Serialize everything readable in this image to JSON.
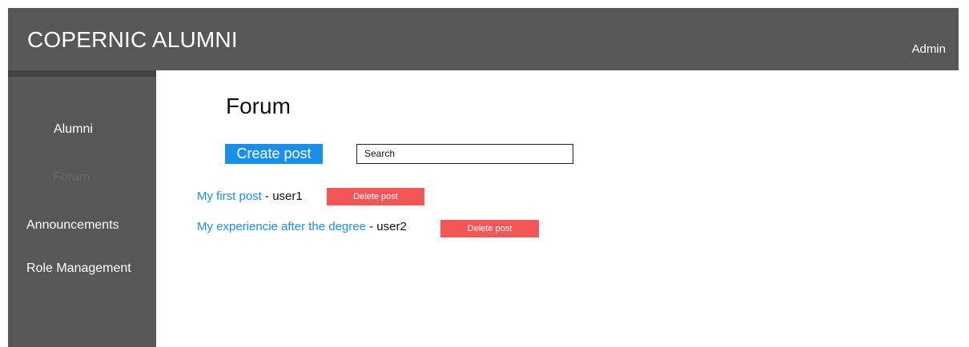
{
  "header": {
    "title": "COPERNIC ALUMNI",
    "user": "Admin"
  },
  "sidebar": {
    "items": [
      {
        "label": "Alumni",
        "active": false
      },
      {
        "label": "Forum",
        "active": true
      },
      {
        "label": "Announcements",
        "active": false
      },
      {
        "label": "Role Management",
        "active": false
      }
    ]
  },
  "main": {
    "title": "Forum",
    "create_label": "Create post",
    "search_value": "Search"
  },
  "posts": [
    {
      "title": "My first post",
      "separator": " - ",
      "author": "user1",
      "delete_label": "Delete post"
    },
    {
      "title": "My experiencie after the degree",
      "separator": " - ",
      "author": "user2",
      "delete_label": "Delete post"
    }
  ],
  "colors": {
    "header_bg": "#575757",
    "accent": "#1a8fe8",
    "danger": "#f25656"
  }
}
